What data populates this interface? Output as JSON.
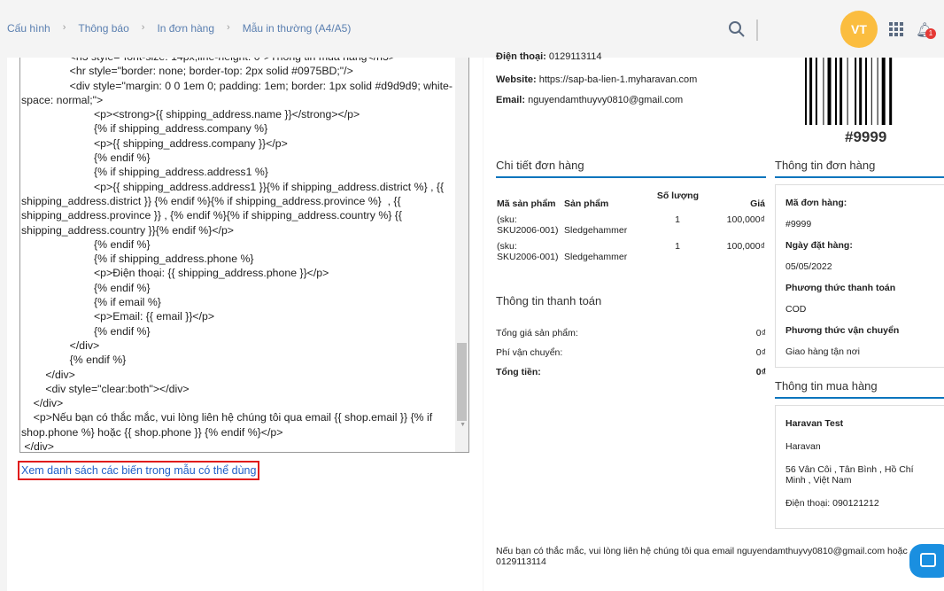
{
  "breadcrumb": [
    "Cấu hình",
    "Thông báo",
    "In đơn hàng",
    "Mẫu in thường (A4/A5)"
  ],
  "header": {
    "avatar": "VT",
    "notification_count": "1"
  },
  "editor": {
    "code": "                <h3 style=\"font-size: 14px;line-height: 0\">Thông tin mua hàng</h3>\n                <hr style=\"border: none; border-top: 2px solid #0975BD;\"/>\n                <div style=\"margin: 0 0 1em 0; padding: 1em; border: 1px solid #d9d9d9; white-space: normal;\">\n                        <p><strong>{{ shipping_address.name }}</strong></p>\n                        {% if shipping_address.company %}\n                        <p>{{ shipping_address.company }}</p>\n                        {% endif %}\n                        {% if shipping_address.address1 %}\n                        <p>{{ shipping_address.address1 }}{% if shipping_address.district %} , {{ shipping_address.district }} {% endif %}{% if shipping_address.province %}  , {{ shipping_address.province }} , {% endif %}{% if shipping_address.country %} {{ shipping_address.country }}{% endif %}</p>\n                        {% endif %}\n                        {% if shipping_address.phone %}\n                        <p>Điện thoại: {{ shipping_address.phone }}</p>\n                        {% endif %}\n                        {% if email %}\n                        <p>Email: {{ email }}</p>\n                        {% endif %}\n                </div>\n                {% endif %}\n        </div>\n        <div style=\"clear:both\"></div>\n    </div>\n    <p>Nếu bạn có thắc mắc, vui lòng liên hệ chúng tôi qua email {{ shop.email }} {% if shop.phone %} hoặc {{ shop.phone }} {% endif %}</p>\n </div>"
  },
  "variables_link": "Xem danh sách các biến trong mẫu có thể dùng",
  "preview": {
    "phone_label": "Điện thoại:",
    "phone": "0129113114",
    "website_label": "Website:",
    "website": "https://sap-ba-lien-1.myharavan.com",
    "email_label": "Email:",
    "email": "nguyendamthuyvy0810@gmail.com",
    "barcode_text": "#9999",
    "order_detail_title": "Chi tiết đơn hàng",
    "columns": [
      "Mã sản phẩm",
      "Sản phẩm",
      "Số lượng",
      "Giá"
    ],
    "rows": [
      {
        "sku": "(sku: SKU2006-001)",
        "product": "Sledgehammer",
        "qty": "1",
        "price": "100,000₫"
      },
      {
        "sku": "(sku: SKU2006-001)",
        "product": "Sledgehammer",
        "qty": "1",
        "price": "100,000₫"
      }
    ],
    "payment_title": "Thông tin thanh toán",
    "payment": [
      {
        "label": "Tổng giá sản phẩm:",
        "value": "0₫"
      },
      {
        "label": "Phí vận chuyển:",
        "value": "0₫"
      },
      {
        "label": "Tổng tiền:",
        "value": "0₫"
      }
    ],
    "order_info_title": "Thông tin đơn hàng",
    "order_info": [
      {
        "label": "Mã đơn hàng:",
        "value": "#9999"
      },
      {
        "label": "Ngày đặt hàng:",
        "value": "05/05/2022"
      },
      {
        "label": "Phương thức thanh toán",
        "value": "COD"
      },
      {
        "label": "Phương thức vận chuyển",
        "value": "Giao hàng tận nơi"
      }
    ],
    "buyer_title": "Thông tin mua hàng",
    "buyer": {
      "name": "Haravan Test",
      "company": "Haravan",
      "address": "56 Vân Côi , Tân Bình , Hồ Chí Minh , Việt Nam",
      "phone": "Điện thoại: 090121212"
    },
    "footer": "Nếu bạn có thắc mắc, vui lòng liên hệ chúng tôi qua email nguyendamthuyvy0810@gmail.com hoặc 0129113114"
  }
}
